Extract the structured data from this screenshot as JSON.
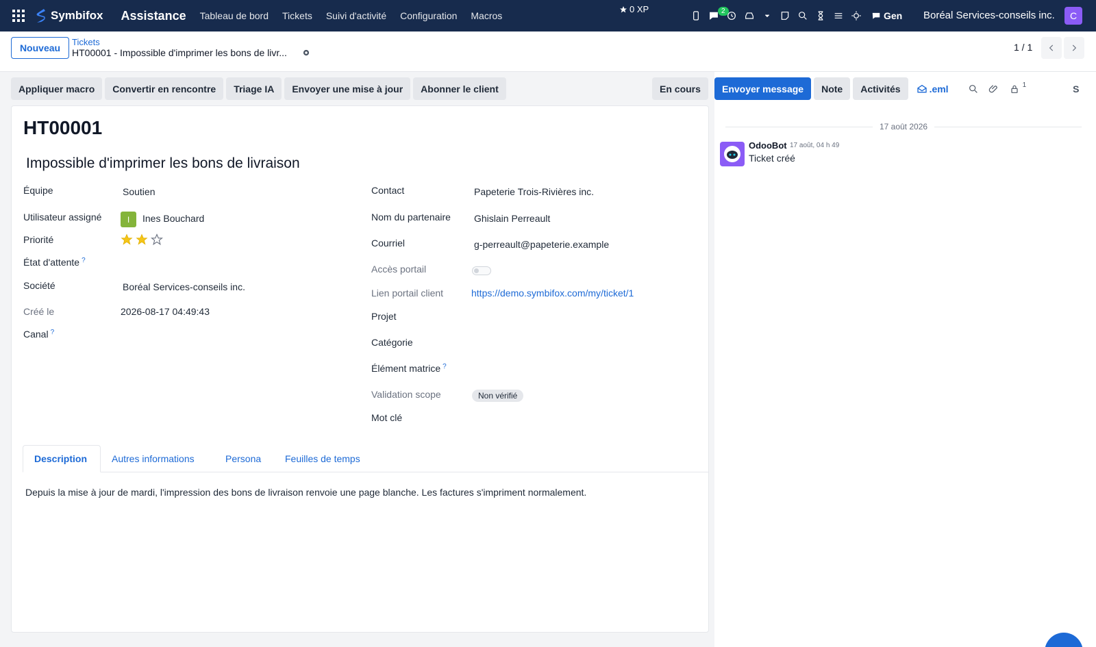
{
  "navbar": {
    "brand": "Symbifox",
    "app": "Assistance",
    "menu": [
      "Tableau de bord",
      "Tickets",
      "Suivi d'activité",
      "Configuration",
      "Macros"
    ],
    "xp": "0 XP",
    "chat_badge": "2",
    "gen": "Gen",
    "company": "Boréal Services-conseils inc.",
    "user_initial": "C",
    "colors": {
      "bar": "#172b4d",
      "avatar": "#8b5cf6",
      "badge": "#22c55e"
    }
  },
  "control_panel": {
    "new_button": "Nouveau",
    "breadcrumb_parent": "Tickets",
    "breadcrumb_current": "HT00001 - Impossible d'imprimer les bons de livr...",
    "pager": "1 / 1"
  },
  "actions": [
    "Appliquer macro",
    "Convertir en rencontre",
    "Triage IA",
    "Envoyer une mise à jour",
    "Abonner le client"
  ],
  "status_button": "En cours",
  "form": {
    "reference": "HT00001",
    "title": "Impossible d'imprimer les bons de livraison",
    "left": {
      "team_label": "Équipe",
      "team_value": "Soutien",
      "user_label": "Utilisateur assigné",
      "user_initial": "I",
      "user_value": "Ines Bouchard",
      "priority_label": "Priorité",
      "priority_stars": 2,
      "priority_max": 3,
      "waiting_label": "État d'attente",
      "company_label": "Société",
      "company_value": "Boréal Services-conseils inc.",
      "created_label": "Créé le",
      "created_value": "2026-08-17 04:49:43",
      "channel_label": "Canal"
    },
    "right": {
      "contact_label": "Contact",
      "contact_value": "Papeterie Trois-Rivières inc.",
      "partner_label": "Nom du partenaire",
      "partner_value": "Ghislain Perreault",
      "email_label": "Courriel",
      "email_value": "g-perreault@papeterie.example",
      "portal_label": "Accès portail",
      "portal_link_label": "Lien portail client",
      "portal_link_value": "https://demo.symbifox.com/my/ticket/1",
      "project_label": "Projet",
      "category_label": "Catégorie",
      "matrix_label": "Élément matrice",
      "scope_label": "Validation scope",
      "scope_value": "Non vérifié",
      "keyword_label": "Mot clé"
    },
    "help_mark": "?",
    "tabs": [
      "Description",
      "Autres informations",
      "Persona",
      "Feuilles de temps"
    ],
    "description": "Depuis la mise à jour de mardi, l'impression des bons de livraison renvoie une page blanche. Les factures s'impriment normalement."
  },
  "chatter": {
    "send_message": "Envoyer message",
    "note": "Note",
    "activities": "Activités",
    "eml": ".eml",
    "followers_count": "1",
    "partial_label": "S",
    "date": "17 août 2026",
    "message": {
      "author": "OdooBot",
      "time": "17 août, 04 h 49",
      "body": "Ticket créé"
    }
  }
}
